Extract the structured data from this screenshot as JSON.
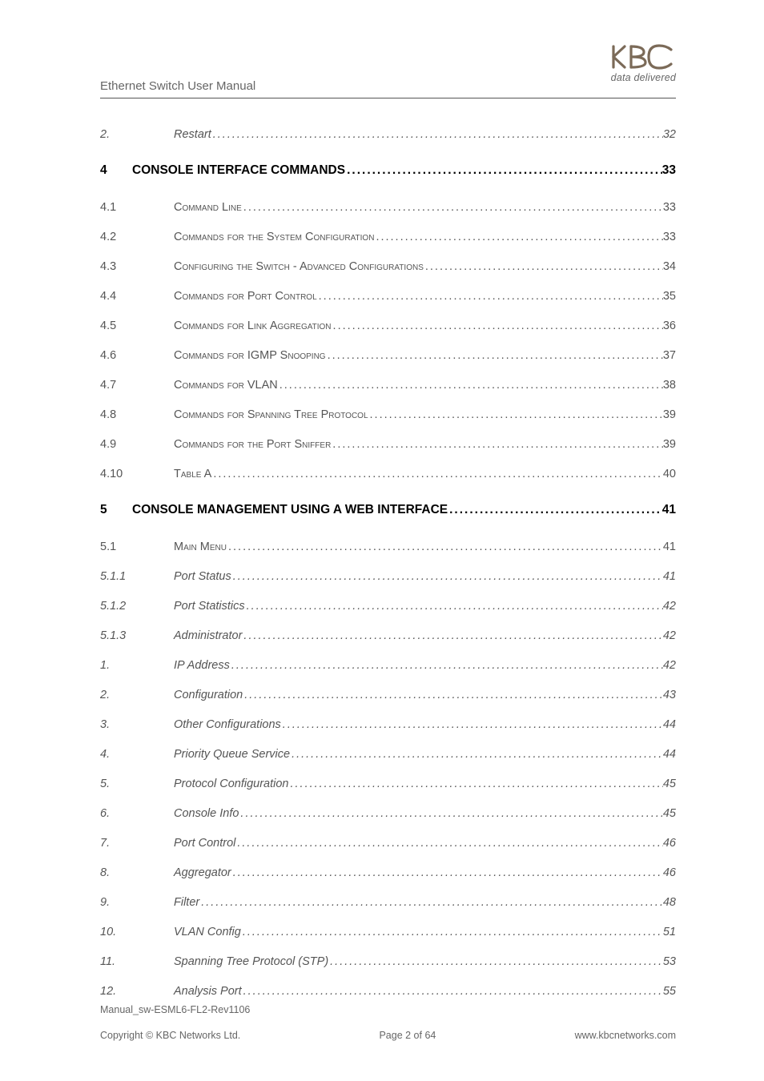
{
  "header": {
    "doc_title": "Ethernet Switch User Manual",
    "logo_tagline": "data delivered"
  },
  "toc": [
    {
      "level": "sub",
      "num": "2.",
      "label": "Restart",
      "page": "32"
    },
    {
      "level": "chapter",
      "num": "4",
      "label": "CONSOLE INTERFACE COMMANDS",
      "page": "33"
    },
    {
      "level": "section",
      "num": "4.1",
      "label": "Command Line",
      "page": "33"
    },
    {
      "level": "section",
      "num": "4.2",
      "label": "Commands for the System Configuration",
      "page": "33"
    },
    {
      "level": "section",
      "num": "4.3",
      "label": "Configuring the Switch - Advanced Configurations",
      "page": "34"
    },
    {
      "level": "section",
      "num": "4.4",
      "label": "Commands for Port Control",
      "page": "35"
    },
    {
      "level": "section",
      "num": "4.5",
      "label": "Commands for Link Aggregation",
      "page": "36"
    },
    {
      "level": "section",
      "num": "4.6",
      "label": "Commands for IGMP Snooping",
      "page": "37"
    },
    {
      "level": "section",
      "num": "4.7",
      "label": "Commands for VLAN",
      "page": "38"
    },
    {
      "level": "section",
      "num": "4.8",
      "label": "Commands for Spanning Tree Protocol",
      "page": "39"
    },
    {
      "level": "section",
      "num": "4.9",
      "label": "Commands for the Port Sniffer",
      "page": "39"
    },
    {
      "level": "section",
      "num": "4.10",
      "label": "Table A",
      "page": "40"
    },
    {
      "level": "chapter",
      "num": "5",
      "label": "CONSOLE MANAGEMENT USING A WEB INTERFACE",
      "page": "41"
    },
    {
      "level": "section",
      "num": "5.1",
      "label": "Main Menu",
      "page": "41"
    },
    {
      "level": "sub",
      "num": "5.1.1",
      "label": "Port Status",
      "page": "41"
    },
    {
      "level": "sub",
      "num": "5.1.2",
      "label": "Port Statistics",
      "page": "42"
    },
    {
      "level": "sub",
      "num": "5.1.3",
      "label": "Administrator",
      "page": "42"
    },
    {
      "level": "sub",
      "num": "1.",
      "label": "IP Address",
      "page": "42"
    },
    {
      "level": "sub",
      "num": "2.",
      "label": "Configuration",
      "page": "43"
    },
    {
      "level": "sub",
      "num": "3.",
      "label": "Other Configurations",
      "page": "44"
    },
    {
      "level": "sub",
      "num": "4.",
      "label": "Priority Queue Service",
      "page": "44"
    },
    {
      "level": "sub",
      "num": "5.",
      "label": "Protocol Configuration",
      "page": "45"
    },
    {
      "level": "sub",
      "num": "6.",
      "label": "Console Info",
      "page": "45"
    },
    {
      "level": "sub",
      "num": "7.",
      "label": "Port Control",
      "page": "46"
    },
    {
      "level": "sub",
      "num": "8.",
      "label": "Aggregator",
      "page": "46"
    },
    {
      "level": "sub",
      "num": "9.",
      "label": "Filter",
      "page": "48"
    },
    {
      "level": "sub",
      "num": "10.",
      "label": "VLAN Config",
      "page": "51"
    },
    {
      "level": "sub",
      "num": "11.",
      "label": "Spanning Tree Protocol (STP)",
      "page": "53"
    },
    {
      "level": "sub",
      "num": "12.",
      "label": "Analysis Port",
      "page": "55"
    }
  ],
  "footer": {
    "revision": "Manual_sw-ESML6-FL2-Rev1106",
    "copyright": "Copyright © KBC Networks Ltd.",
    "page_label": "Page 2 of 64",
    "url": "www.kbcnetworks.com"
  }
}
